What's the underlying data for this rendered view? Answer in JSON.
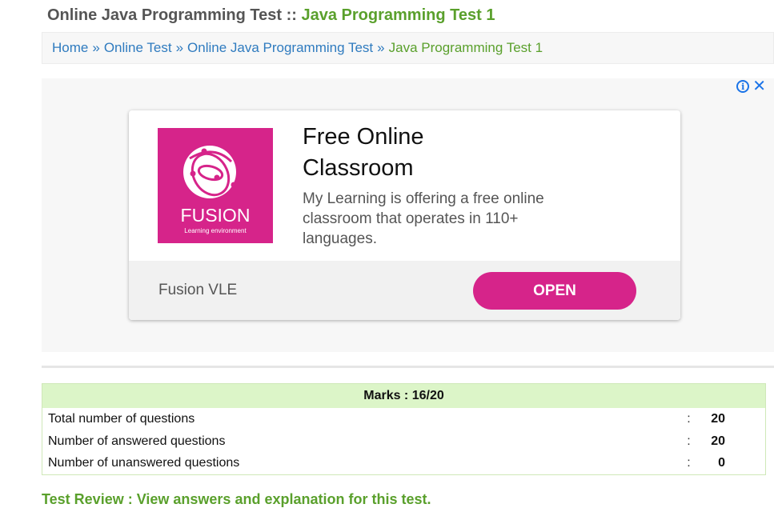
{
  "title": {
    "prefix": "Online Java Programming Test ::",
    "accent": "Java Programming Test 1"
  },
  "breadcrumb": {
    "items": [
      "Home",
      "Online Test",
      "Online Java Programming Test"
    ],
    "separator": "»",
    "current": "Java Programming Test 1"
  },
  "ad": {
    "logo_text": "FUSION",
    "logo_subtext": "Learning environment",
    "headline": "Free Online Classroom",
    "description": "My Learning is offering a free online classroom that operates in 110+ languages.",
    "brand": "Fusion VLE",
    "open_label": "OPEN",
    "colors": {
      "brand": "#d6248a",
      "control": "#1a73e8"
    }
  },
  "result": {
    "marks_label": "Marks : 16/20",
    "rows": [
      {
        "label": "Total number of questions",
        "colon": ":",
        "value": "20"
      },
      {
        "label": "Number of answered questions",
        "colon": ":",
        "value": "20"
      },
      {
        "label": "Number of unanswered questions",
        "colon": ":",
        "value": "0"
      }
    ]
  },
  "cutoff_heading": "Test Review : View answers and explanation for this test."
}
